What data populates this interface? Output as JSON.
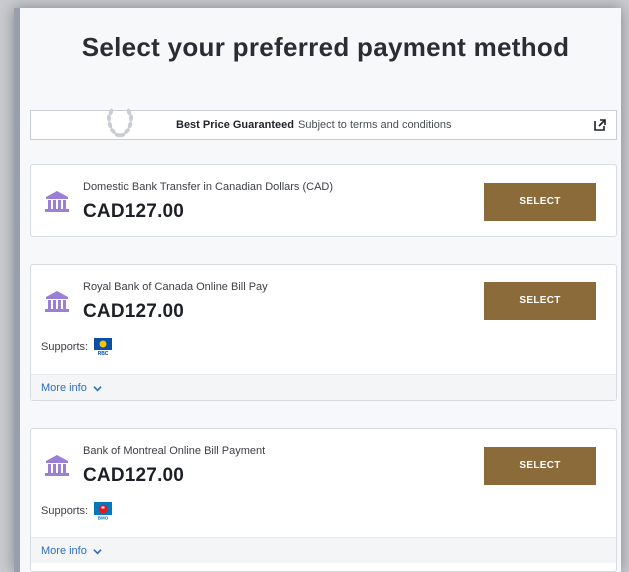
{
  "page": {
    "title": "Select your preferred payment method"
  },
  "guarantee": {
    "label": "Best Price Guaranteed",
    "subtext": "Subject to terms and conditions",
    "icon": "external-link-icon"
  },
  "methods": [
    {
      "name": "Domestic Bank Transfer in Canadian Dollars (CAD)",
      "amount": "CAD127.00",
      "button": "SELECT",
      "icon": "bank-icon"
    },
    {
      "name": "Royal Bank of Canada Online Bill Pay",
      "amount": "CAD127.00",
      "button": "SELECT",
      "supports_label": "Supports:",
      "logo": "RBC",
      "more_info": "More info",
      "icon": "bank-icon"
    },
    {
      "name": "Bank of Montreal Online Bill Payment",
      "amount": "CAD127.00",
      "button": "SELECT",
      "supports_label": "Supports:",
      "logo": "BMO",
      "more_info": "More info",
      "icon": "bank-icon"
    }
  ],
  "colors": {
    "accent": "#8c6b3a",
    "bank_icon": "#9b7fd4",
    "link": "#2f6fb5"
  }
}
